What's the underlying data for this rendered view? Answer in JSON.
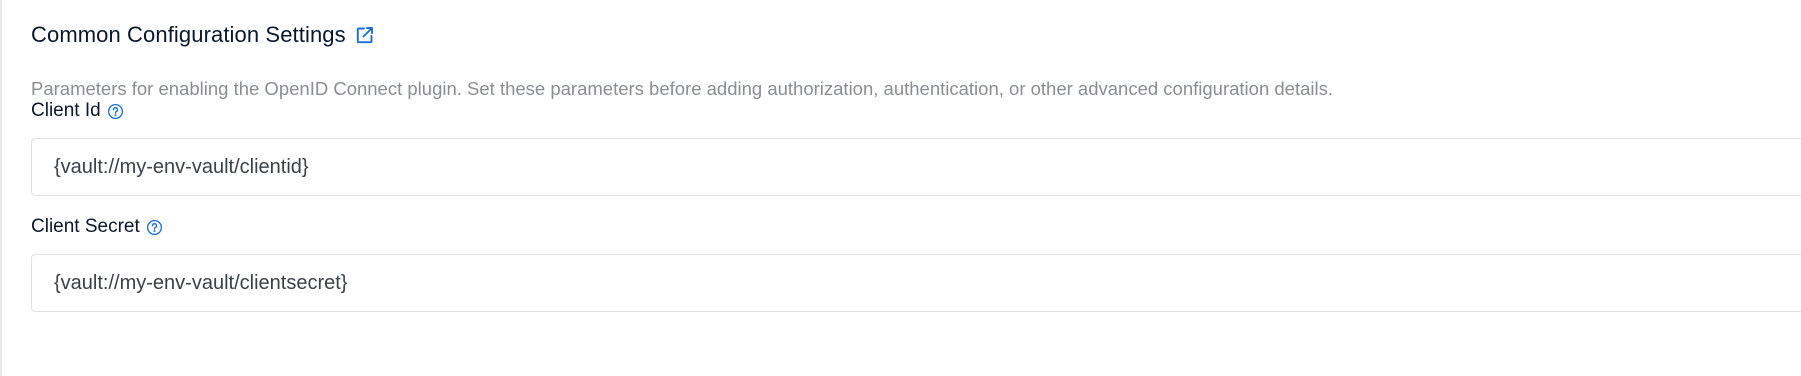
{
  "section": {
    "title": "Common Configuration Settings",
    "external_link_icon": "external-link-icon",
    "description": "Parameters for enabling the OpenID Connect plugin. Set these parameters before adding authorization, authentication, or other advanced configuration details."
  },
  "fields": {
    "client_id": {
      "label": "Client Id",
      "help_icon": "question-circle-icon",
      "value": "{vault://my-env-vault/clientid}"
    },
    "client_secret": {
      "label": "Client Secret",
      "help_icon": "question-circle-icon",
      "value": "{vault://my-env-vault/clientsecret}"
    }
  },
  "colors": {
    "accent": "#1c6fd6",
    "title_text": "#0b172a",
    "description_text": "#8a8d94",
    "input_text": "#3c4048",
    "input_border": "#e0e1e6"
  }
}
